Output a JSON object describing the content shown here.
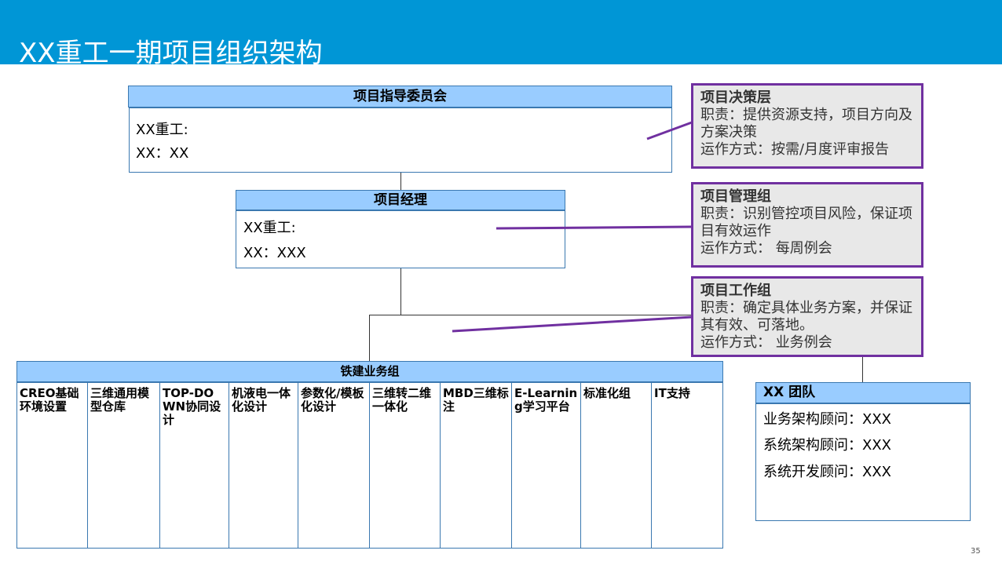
{
  "title": "XX重工一期项目组织架构",
  "steering": {
    "header": "项目指导委员会",
    "line1": "XX重工:",
    "line2": "XX：XX"
  },
  "pm": {
    "header": "项目经理",
    "line1": "XX重工:",
    "line2": "XX：XXX"
  },
  "notes": [
    {
      "title": "项目决策层",
      "duty": "职责：提供资源支持，项目方向及方案决策",
      "mode": "运作方式：按需/月度评审报告"
    },
    {
      "title": "项目管理组",
      "duty": "职责：识别管控项目风险，保证项目有效运作",
      "mode": "运作方式： 每周例会"
    },
    {
      "title": "项目工作组",
      "duty": "职责：确定具体业务方案，并保证其有效、可落地。",
      "mode": "运作方式： 业务例会"
    }
  ],
  "business": {
    "header": "铁建业务组",
    "columns": [
      "CREO基础环境设置",
      "三维通用模型仓库",
      "TOP-DOWN协同设计",
      "机液电一体化设计",
      "参数化/模板化设计",
      "三维转二维一体化",
      "MBD三维标注",
      "E-Learning学习平台",
      "标准化组",
      "IT支持"
    ]
  },
  "team": {
    "header": "XX 团队",
    "members": [
      "业务架构顾问：XXX",
      "系统架构顾问：XXX",
      "系统开发顾问：XXX"
    ]
  },
  "page_number": "35",
  "colors": {
    "header": "#0096d6",
    "bar": "#99ccff",
    "note_border": "#7030a0",
    "note_bg": "#e8e8e8"
  }
}
